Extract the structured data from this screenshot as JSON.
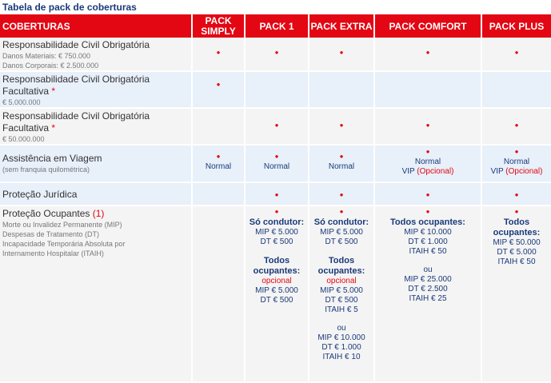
{
  "title": "Tabela de pack de coberturas",
  "headers": {
    "coberturas": "COBERTURAS",
    "simply_l1": "PACK",
    "simply_l2": "SIMPLY",
    "pack1": "PACK 1",
    "extra": "PACK EXTRA",
    "comfort": "PACK COMFORT",
    "plus": "PACK PLUS"
  },
  "bullet": "•",
  "star": "*",
  "rows": {
    "rc": {
      "label": "Responsabilidade Civil Obrigatória",
      "sub1": "Danos Materiais: € 750.000",
      "sub2": "Danos Corporais: € 2.500.000"
    },
    "rcf5": {
      "label_l1": "Responsabilidade Civil Obrigatória",
      "label_l2": "Facultativa",
      "sub": "€ 5.000.000"
    },
    "rcf50": {
      "label_l1": "Responsabilidade Civil Obrigatória",
      "label_l2": "Facultativa",
      "sub": "€ 50.000.000"
    },
    "assist": {
      "label": "Assistência em Viagem",
      "sub": "(sem franquia quilométrica)",
      "normal": "Normal",
      "vip": "VIP",
      "opcional": "(Opcional)"
    },
    "juridica": {
      "label": "Proteção Jurídica"
    },
    "ocupantes": {
      "label": "Proteção Ocupantes",
      "label_note": "(1)",
      "sub1": "Morte ou Invalidez Permanente (MIP)",
      "sub2": "Despesas de Tratamento (DT)",
      "sub3": "Incapacidade Temporária Absoluta por",
      "sub4": "Internamento Hospitalar (ITAIH)",
      "pack1": {
        "so_condutor": "Só condutor:",
        "mip": "MIP € 5.000",
        "dt": "DT € 500",
        "todos_l1": "Todos",
        "todos_l2": "ocupantes:",
        "opcional": "opcional",
        "mip2": "MIP € 5.000",
        "dt2": "DT € 500"
      },
      "extra": {
        "so_condutor": "Só condutor:",
        "mip": "MIP € 5.000",
        "dt": "DT € 500",
        "todos_l1": "Todos",
        "todos_l2": "ocupantes:",
        "opcional": "opcional",
        "mip2": "MIP € 5.000",
        "dt2": "DT € 500",
        "itaih2": "ITAIH € 5",
        "ou": "ou",
        "mip3": "MIP € 10.000",
        "dt3": "DT € 1.000",
        "itaih3": "ITAIH € 10"
      },
      "comfort": {
        "todos": "Todos ocupantes:",
        "mip": "MIP € 10.000",
        "dt": "DT € 1.000",
        "itaih": "ITAIH € 50",
        "ou": "ou",
        "mip2": "MIP € 25.000",
        "dt2": "DT € 2.500",
        "itaih2": "ITAIH € 25"
      },
      "plus": {
        "todos_l1": "Todos",
        "todos_l2": "ocupantes:",
        "mip": "MIP € 50.000",
        "dt": "DT € 5.000",
        "itaih": "ITAIH € 50"
      }
    }
  },
  "colors": {
    "header_bg": "#e30613",
    "title_text": "#1a3a7a",
    "row_blue": "#e8f0fa",
    "row_grey": "#f4f4f4",
    "accent_red": "#e30613"
  }
}
